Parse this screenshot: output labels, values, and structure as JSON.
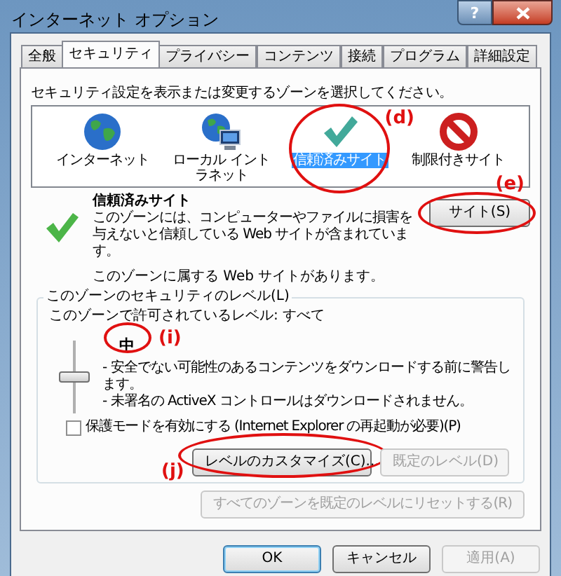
{
  "window": {
    "title": "インターネット オプション",
    "help_label": "?"
  },
  "tabs": [
    {
      "label": "全般",
      "selected": false
    },
    {
      "label": "セキュリティ",
      "selected": true
    },
    {
      "label": "プライバシー",
      "selected": false
    },
    {
      "label": "コンテンツ",
      "selected": false
    },
    {
      "label": "接続",
      "selected": false
    },
    {
      "label": "プログラム",
      "selected": false
    },
    {
      "label": "詳細設定",
      "selected": false
    }
  ],
  "instruction": "セキュリティ設定を表示または変更するゾーンを選択してください。",
  "zones": [
    {
      "label": "インターネット",
      "kind": "internet",
      "selected": false
    },
    {
      "label": "ローカル イントラネット",
      "kind": "intranet",
      "selected": false
    },
    {
      "label": "信頼済みサイト",
      "kind": "trusted",
      "selected": true,
      "annotation": "(d)"
    },
    {
      "label": "制限付きサイト",
      "kind": "restricted",
      "selected": false
    }
  ],
  "zone_info": {
    "title": "信頼済みサイト",
    "description": "このゾーンには、コンピューターやファイルに損害を与えないと信頼している Web サイトが含まれています。",
    "sites_button": {
      "label": "サイト(S)",
      "annotation": "(e)"
    },
    "note": "このゾーンに属する Web サイトがあります。"
  },
  "security_level": {
    "legend": "このゾーンのセキュリティのレベル(L)",
    "allowed": "このゾーンで許可されているレベル: すべて",
    "level_name": "中",
    "annotation": "(i)",
    "level": 0.5,
    "bullets": [
      "- 安全でない可能性のあるコンテンツをダウンロードする前に警告します。",
      "- 未署名の ActiveX コントロールはダウンロードされません。"
    ],
    "protected_mode": {
      "label": "保護モードを有効にする (Internet Explorer の再起動が必要)(P)",
      "checked": false
    },
    "buttons": [
      {
        "label": "レベルのカスタマイズ(C)...",
        "disabled": false,
        "annotation": "(j)"
      },
      {
        "label": "既定のレベル(D)",
        "disabled": true
      }
    ]
  },
  "reset_button": {
    "label": "すべてのゾーンを既定のレベルにリセットする(R)",
    "disabled": true
  },
  "dialog_buttons": [
    {
      "label": "OK",
      "disabled": false,
      "default": true
    },
    {
      "label": "キャンセル",
      "disabled": false,
      "default": false
    },
    {
      "label": "適用(A)",
      "disabled": true,
      "default": false
    }
  ]
}
